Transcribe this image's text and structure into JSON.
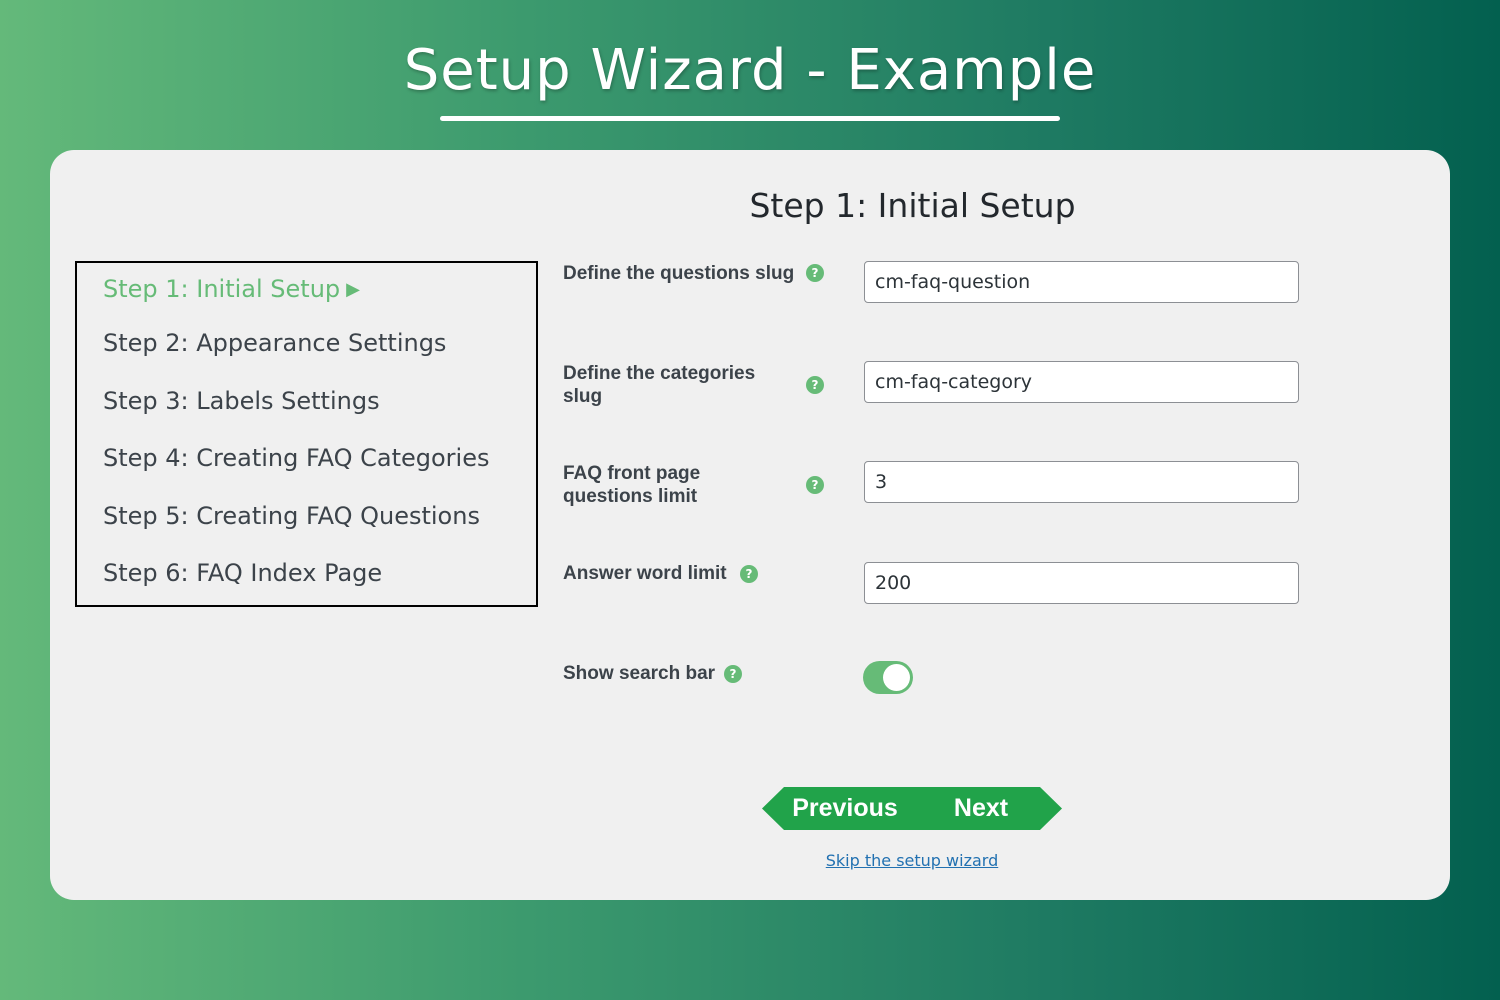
{
  "header": {
    "title": "Setup Wizard - Example"
  },
  "main": {
    "heading": "Step 1: Initial Setup"
  },
  "steps": [
    {
      "label": "Step 1: Initial Setup",
      "active": true
    },
    {
      "label": "Step 2: Appearance Settings",
      "active": false
    },
    {
      "label": "Step 3: Labels Settings",
      "active": false
    },
    {
      "label": "Step 4: Creating FAQ Categories",
      "active": false
    },
    {
      "label": "Step 5: Creating FAQ Questions",
      "active": false
    },
    {
      "label": "Step 6: FAQ Index Page",
      "active": false
    }
  ],
  "fields": {
    "questions_slug": {
      "label": "Define the questions slug",
      "value": "cm-faq-question"
    },
    "categories_slug": {
      "label_line1": "Define the categories",
      "label_line2": "slug",
      "value": "cm-faq-category"
    },
    "front_page_limit": {
      "label_line1": "FAQ front page",
      "label_line2": "questions limit",
      "value": "3"
    },
    "answer_word_limit": {
      "label": "Answer word limit",
      "value": "200"
    },
    "show_search_bar": {
      "label": "Show search bar",
      "enabled": true
    }
  },
  "help_glyph": "?",
  "step_arrow_glyph": "▶",
  "buttons": {
    "previous": "Previous",
    "next": "Next"
  },
  "skip_link": "Skip the setup wizard",
  "colors": {
    "accent": "#66bb77",
    "button": "#21a34a",
    "link": "#2271b1",
    "card": "#f0f0f0"
  }
}
